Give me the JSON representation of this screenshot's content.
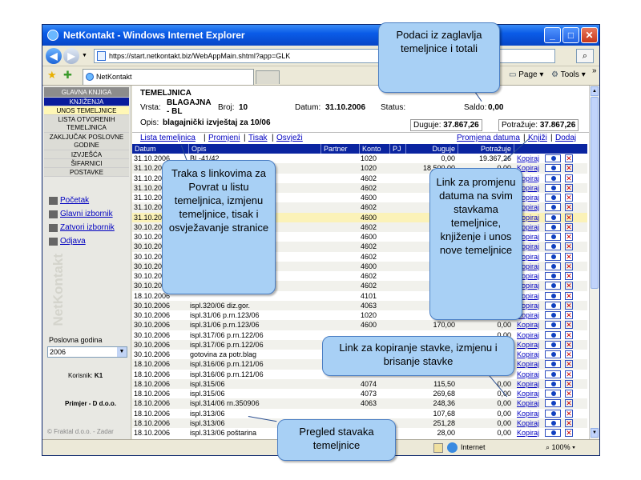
{
  "window": {
    "title": "NetKontakt - Windows Internet Explorer",
    "url": "https://start.netkontakt.biz/WebAppMain.shtml?app=GLK",
    "tab_label": "NetKontakt",
    "page_menu": "Page",
    "tools_menu": "Tools",
    "more": "»",
    "min": "_",
    "max": "□",
    "close": "✕"
  },
  "sidebar": {
    "menu": [
      {
        "label": "GLAVNA KNJIGA",
        "style": "head"
      },
      {
        "label": "KNJIŽENJA",
        "style": "blue"
      },
      {
        "label": "UNOS TEMELJNICE",
        "style": "yellow"
      },
      {
        "label": "LISTA OTVORENIH TEMELJNICA",
        "style": "two"
      },
      {
        "label": "ZAKLJUČAK POSLOVNE GODINE",
        "style": "two"
      },
      {
        "label": "IZVJEŠĆA",
        "style": "grey"
      },
      {
        "label": "ŠIFARNICI",
        "style": "grey"
      },
      {
        "label": "POSTAVKE",
        "style": "grey"
      }
    ],
    "links": [
      "Početak",
      "Glavni izbornik",
      "Zatvori izbornik",
      "Odjava"
    ],
    "year_label": "Poslovna godina",
    "year_value": "2006",
    "korisnik_label": "Korisnik:",
    "korisnik_value": "K1",
    "firma": "Primjer - D d.o.o.",
    "footer": "© Fraktal d.o.o. - Zadar",
    "watermark": "NetKontakt"
  },
  "header": {
    "title": "TEMELJNICA",
    "vrsta_label": "Vrsta:",
    "vrsta_value_1": "BLAGAJNA",
    "vrsta_value_2": "- BL",
    "broj_label": "Broj:",
    "broj_value": "10",
    "datum_label": "Datum:",
    "datum_value": "31.10.2006",
    "status_label": "Status:",
    "saldo_label": "Saldo:",
    "saldo_value": "0,00",
    "opis_label": "Opis:",
    "opis_value": "blagajnički izvještaj za 10/06",
    "duguje_label": "Duguje:",
    "duguje_value": "37.867,26",
    "potrazuje_label": "Potražuje:",
    "potrazuje_value": "37.867,26"
  },
  "links": {
    "lista": "Lista temeljnica",
    "promjeni": "Promjeni",
    "tisak": "Tisak",
    "osvjezi": "Osvježi",
    "promjena_datuma": "Promjena datuma",
    "knjizi": "Knjiži",
    "dodaj": "Dodaj"
  },
  "grid": {
    "columns": [
      "Datum",
      "Opis",
      "Partner",
      "Konto",
      "PJ",
      "Duguje",
      "Potražuje"
    ],
    "kopiraj": "Kopiraj",
    "del_glyph": "✕",
    "rows": [
      {
        "datum": "31.10.2006",
        "opis": "BL-41/42",
        "konto": "1020",
        "duguje": "0,00",
        "potrazuje": "19.367,26"
      },
      {
        "datum": "31.10.2006",
        "opis": "",
        "konto": "1020",
        "duguje": "18.500,00",
        "potrazuje": "0,00"
      },
      {
        "datum": "31.10.2006",
        "opis": "",
        "konto": "4602",
        "duguje": "",
        "potrazuje": ""
      },
      {
        "datum": "31.10.2006",
        "opis": "",
        "konto": "4602",
        "duguje": "",
        "potrazuje": ""
      },
      {
        "datum": "31.10.2006",
        "opis": "",
        "konto": "4600",
        "duguje": "",
        "potrazuje": ""
      },
      {
        "datum": "31.10.2006",
        "opis": "",
        "konto": "4602",
        "duguje": "",
        "potrazuje": ""
      },
      {
        "datum": "31.10.2006",
        "opis": "",
        "konto": "4600",
        "duguje": "",
        "potrazuje": ""
      },
      {
        "datum": "30.10.2006",
        "opis": "",
        "konto": "4602",
        "duguje": "",
        "potrazuje": ""
      },
      {
        "datum": "30.10.2006",
        "opis": "",
        "konto": "4600",
        "duguje": "",
        "potrazuje": ""
      },
      {
        "datum": "30.10.2006",
        "opis": "",
        "konto": "4602",
        "duguje": "",
        "potrazuje": ""
      },
      {
        "datum": "30.10.2006",
        "opis": "",
        "konto": "4602",
        "duguje": "",
        "potrazuje": ""
      },
      {
        "datum": "30.10.2006",
        "opis": "",
        "konto": "4600",
        "duguje": "",
        "potrazuje": ""
      },
      {
        "datum": "30.10.2006",
        "opis": "",
        "konto": "4602",
        "duguje": "",
        "potrazuje": ""
      },
      {
        "datum": "30.10.2006",
        "opis": "",
        "konto": "4602",
        "duguje": "",
        "potrazuje": ""
      },
      {
        "datum": "18.10.2006",
        "opis": "",
        "konto": "4101",
        "duguje": "",
        "potrazuje": ""
      },
      {
        "datum": "30.10.2006",
        "opis": "ispl.320/06 diz.gor.",
        "konto": "4063",
        "duguje": "",
        "potrazuje": ""
      },
      {
        "datum": "30.10.2006",
        "opis": "ispl.31/06 p.rn.123/06",
        "konto": "1020",
        "duguje": "",
        "potrazuje": ""
      },
      {
        "datum": "30.10.2006",
        "opis": "ispl.31/06 p.rn.123/06",
        "konto": "4600",
        "duguje": "170,00",
        "potrazuje": "0,00"
      },
      {
        "datum": "30.10.2006",
        "opis": "ispl.317/06 p.rn.122/06",
        "konto": "",
        "duguje": "",
        "potrazuje": "0,00"
      },
      {
        "datum": "30.10.2006",
        "opis": "ispl.317/06 p.rn.122/06",
        "konto": "",
        "duguje": "",
        "potrazuje": ""
      },
      {
        "datum": "30.10.2006",
        "opis": "gotovina za potr.blag",
        "konto": "",
        "duguje": "",
        "potrazuje": ""
      },
      {
        "datum": "18.10.2006",
        "opis": "ispl.316/06 p.rn.121/06",
        "konto": "",
        "duguje": "",
        "potrazuje": ""
      },
      {
        "datum": "18.10.2006",
        "opis": "ispl.316/06 p.rn.121/06",
        "konto": "",
        "duguje": "",
        "potrazuje": ""
      },
      {
        "datum": "18.10.2006",
        "opis": "ispl.315/06",
        "konto": "4074",
        "duguje": "115,50",
        "potrazuje": "0,00"
      },
      {
        "datum": "18.10.2006",
        "opis": "ispl.315/06",
        "konto": "4073",
        "duguje": "269,68",
        "potrazuje": "0,00"
      },
      {
        "datum": "18.10.2006",
        "opis": "ispl.314/06 rn.350906",
        "konto": "4063",
        "duguje": "248,36",
        "potrazuje": "0,00"
      },
      {
        "datum": "18.10.2006",
        "opis": "ispl.313/06",
        "konto": "",
        "duguje": "107,68",
        "potrazuje": "0,00"
      },
      {
        "datum": "18.10.2006",
        "opis": "ispl.313/06",
        "konto": "",
        "duguje": "251,28",
        "potrazuje": "0,00"
      },
      {
        "datum": "18.10.2006",
        "opis": "ispl.313/06 poštarina",
        "konto": "",
        "duguje": "28,00",
        "potrazuje": "0,00"
      }
    ]
  },
  "status": {
    "zone": "Internet",
    "zoom": "100%"
  },
  "callouts": {
    "c1": "Podaci iz zaglavlja temeljnice i totali",
    "c2": "Traka s linkovima za Povrat u listu temeljnica, izmjenu temeljnice, tisak i osvježavanje stranice",
    "c3": "Link za promjenu datuma na svim stavkama temeljnice, knjiženje i unos nove temeljnice",
    "c4": "Link za kopiranje stavke, izmjenu i brisanje stavke",
    "c5": "Pregled stavaka temeljnice"
  }
}
